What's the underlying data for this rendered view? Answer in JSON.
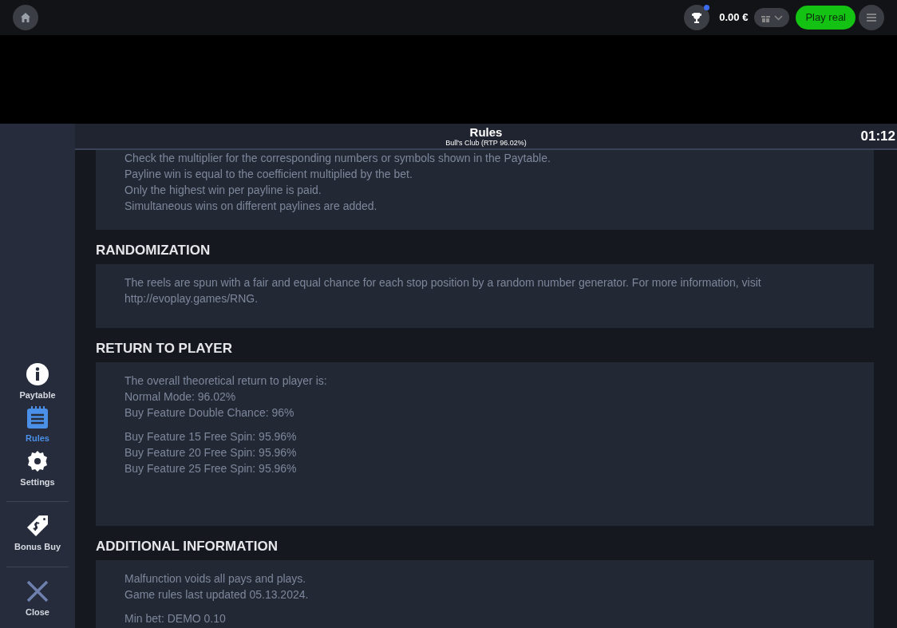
{
  "top_bar": {
    "balance": "0.00 €",
    "trophy_notification": true,
    "play_button": "Play real"
  },
  "sidebar": {
    "groups": [
      [
        {
          "kind": "info",
          "label": "Paytable",
          "selected": false
        },
        {
          "kind": "rules",
          "label": "Rules",
          "selected": true
        },
        {
          "kind": "gear",
          "label": "Settings",
          "selected": false
        }
      ],
      [
        {
          "kind": "tag",
          "label": "Bonus Buy",
          "selected": false
        }
      ],
      [
        {
          "kind": "close",
          "label": "Close",
          "selected": false
        }
      ]
    ]
  },
  "header": {
    "title": "Rules",
    "subtitle": "Bull's Club (RTP 96.02%)",
    "timer": "01:12"
  },
  "sections": [
    {
      "paragraphs": [
        [
          "Check the multiplier for the corresponding numbers or symbols shown in the Paytable.",
          "Payline win is equal to the coefficient multiplied by the bet.",
          "Only the highest win per payline is paid.",
          "Simultaneous wins on different paylines are added."
        ]
      ]
    },
    {
      "heading": "RANDOMIZATION",
      "paragraphs": [
        [
          "The reels are spun with a fair and equal chance for each stop position by a random number generator. For more information, visit http://evoplay.games/RNG."
        ]
      ]
    },
    {
      "heading": "RETURN TO PLAYER",
      "paragraphs": [
        [
          "The overall theoretical return to player is:",
          "Normal Mode: 96.02%",
          "Buy Feature Double Chance: 96%"
        ],
        [
          "Buy Feature 15 Free Spin: 95.96%",
          "Buy Feature 20 Free Spin: 95.96%",
          "Buy Feature 25 Free Spin: 95.96%"
        ]
      ]
    },
    {
      "heading": "ADDITIONAL INFORMATION",
      "paragraphs": [
        [
          "Malfunction voids all pays and plays.",
          "Game rules last updated 05.13.2024."
        ],
        [
          "Min bet: DEMO 0.10"
        ]
      ]
    }
  ]
}
